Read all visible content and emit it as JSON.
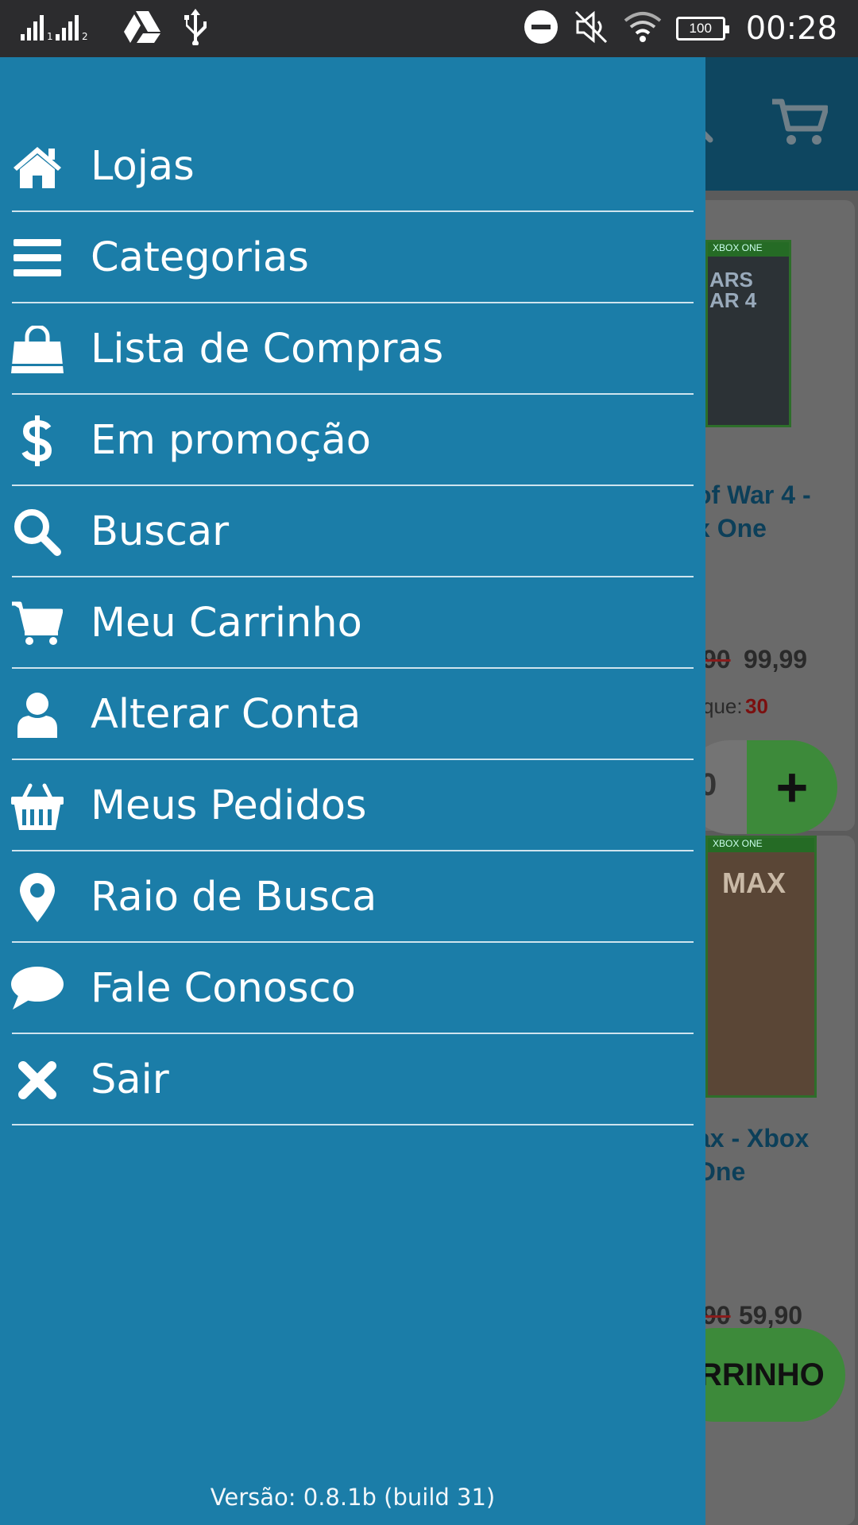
{
  "status_bar": {
    "time": "00:28",
    "battery": "100",
    "icons": [
      "signal-icon",
      "drive-icon",
      "usb-icon",
      "do-not-disturb-icon",
      "mute-icon",
      "wifi-icon",
      "battery-icon"
    ]
  },
  "drawer": {
    "items": [
      {
        "label": "Lojas",
        "icon": "home-icon"
      },
      {
        "label": "Categorias",
        "icon": "menu-lines-icon"
      },
      {
        "label": "Lista de Compras",
        "icon": "shopping-bag-icon"
      },
      {
        "label": "Em promoção",
        "icon": "dollar-icon"
      },
      {
        "label": "Buscar",
        "icon": "search-icon"
      },
      {
        "label": "Meu Carrinho",
        "icon": "cart-icon"
      },
      {
        "label": "Alterar Conta",
        "icon": "user-icon"
      },
      {
        "label": "Meus Pedidos",
        "icon": "basket-icon"
      },
      {
        "label": "Raio de Busca",
        "icon": "map-pin-icon"
      },
      {
        "label": "Fale Conosco",
        "icon": "chat-icon"
      },
      {
        "label": "Sair",
        "icon": "close-icon"
      }
    ],
    "version": "Versão: 0.8.1b (build 31)"
  },
  "background": {
    "product1": {
      "cover_band": "XBOX ONE",
      "cover_title": "ARS\nAR 4",
      "title_line1": "of War 4 -",
      "title_line2": "x One",
      "old_price": "90",
      "new_price": "99,99",
      "stock_label": "que:",
      "stock_value": "30",
      "qty": "0",
      "plus": "+"
    },
    "product2": {
      "cover_band": "XBOX ONE",
      "cover_title": "MAX",
      "title_line1": "ax - Xbox",
      "title_line2": "One",
      "old_price": "90",
      "new_price": "59,90"
    },
    "cart_button": "RRINHO"
  },
  "colors": {
    "drawer": "#1b7da8",
    "divider": "#cfe4ee",
    "status_bar": "#2c2c2e"
  }
}
